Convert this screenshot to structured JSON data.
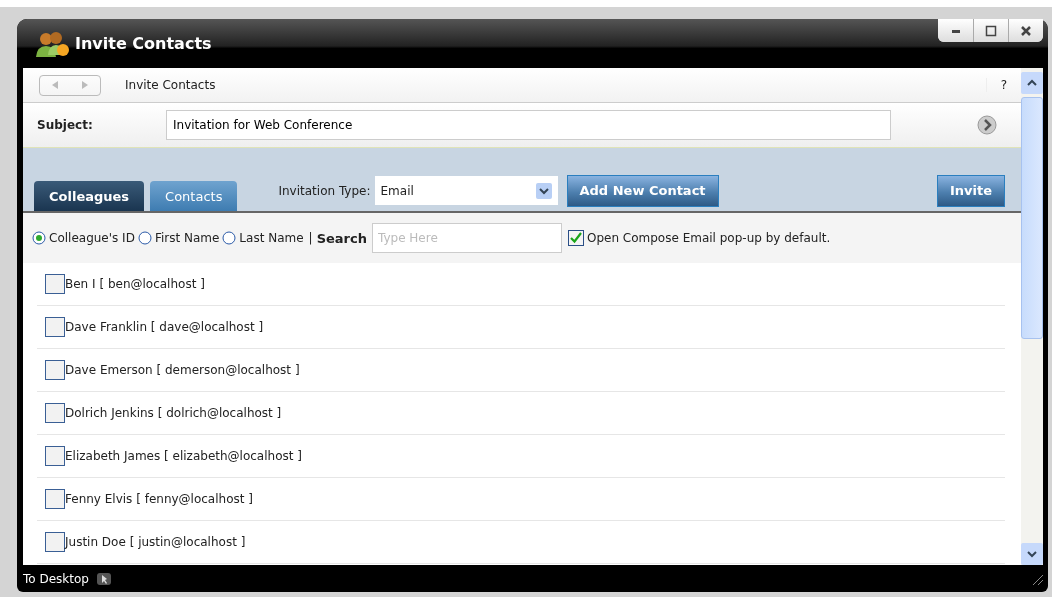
{
  "window": {
    "title": "Invite Contacts"
  },
  "nav": {
    "title": "Invite Contacts",
    "help": "?"
  },
  "subject": {
    "label": "Subject:",
    "value": "Invitation for Web Conference"
  },
  "tabs": [
    {
      "label": "Colleagues",
      "selected": true
    },
    {
      "label": "Contacts",
      "selected": false
    }
  ],
  "invitation_type": {
    "label": "Invitation Type:",
    "value": "Email"
  },
  "buttons": {
    "add": "Add New Contact",
    "invite": "Invite"
  },
  "search_by": [
    {
      "label": "Colleague's ID",
      "selected": true
    },
    {
      "label": "First Name",
      "selected": false
    },
    {
      "label": "Last Name",
      "selected": false
    }
  ],
  "search": {
    "separator": "|",
    "label": "Search",
    "placeholder": "Type Here"
  },
  "compose_option": {
    "label": "Open Compose Email pop-up by default.",
    "checked": true
  },
  "contacts": [
    {
      "label": "Ben I [ ben@localhost ]",
      "checked": false
    },
    {
      "label": "Dave Franklin [ dave@localhost ]",
      "checked": false
    },
    {
      "label": "Dave Emerson [ demerson@localhost ]",
      "checked": false
    },
    {
      "label": "Dolrich Jenkins [ dolrich@localhost ]",
      "checked": false
    },
    {
      "label": "Elizabeth James [ elizabeth@localhost ]",
      "checked": false
    },
    {
      "label": "Fenny Elvis [ fenny@localhost ]",
      "checked": false
    },
    {
      "label": "Justin Doe [ justin@localhost ]",
      "checked": false
    }
  ],
  "status_bar": {
    "label": "To Desktop"
  }
}
